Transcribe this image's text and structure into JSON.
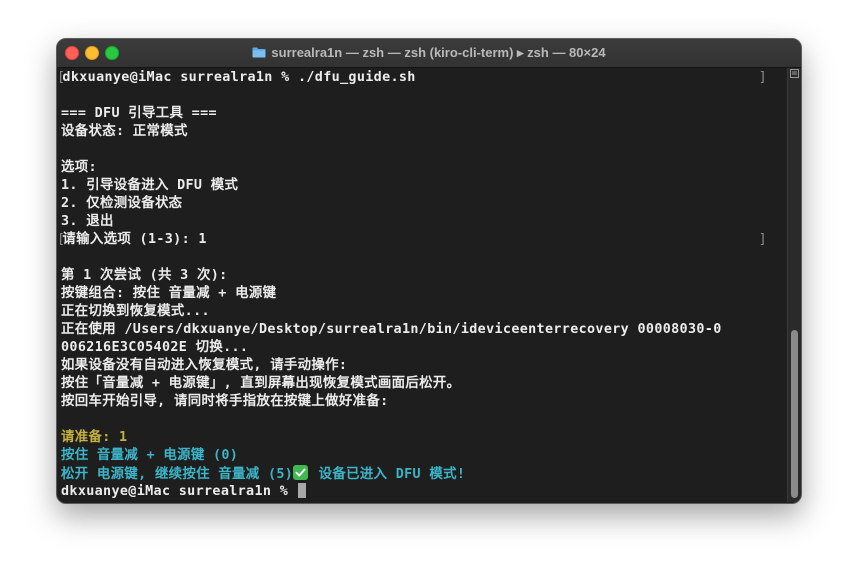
{
  "window": {
    "title": "surrealra1n — zsh — zsh (kiro-cli-term) ▸ zsh — 80×24"
  },
  "terminal": {
    "lines": [
      {
        "text": "dkxuanye@iMac surrealra1n % ./dfu_guide.sh",
        "style": "normal",
        "marked": true
      },
      {
        "text": "",
        "style": "normal"
      },
      {
        "text": "=== DFU 引导工具 ===",
        "style": "normal"
      },
      {
        "text": "设备状态: 正常模式",
        "style": "normal"
      },
      {
        "text": "",
        "style": "normal"
      },
      {
        "text": "选项:",
        "style": "normal"
      },
      {
        "text": "1. 引导设备进入 DFU 模式",
        "style": "normal"
      },
      {
        "text": "2. 仅检测设备状态",
        "style": "normal"
      },
      {
        "text": "3. 退出",
        "style": "normal"
      },
      {
        "text": "请输入选项 (1-3): 1",
        "style": "normal",
        "marked": true
      },
      {
        "text": "",
        "style": "normal"
      },
      {
        "text": "第 1 次尝试 (共 3 次):",
        "style": "normal"
      },
      {
        "text": "按键组合: 按住 音量减 + 电源键",
        "style": "normal"
      },
      {
        "text": "正在切换到恢复模式...",
        "style": "normal"
      },
      {
        "text": "正在使用 /Users/dkxuanye/Desktop/surrealra1n/bin/ideviceenterrecovery 00008030-0",
        "style": "normal"
      },
      {
        "text": "006216E3C05402E 切换...",
        "style": "normal"
      },
      {
        "text": "如果设备没有自动进入恢复模式, 请手动操作:",
        "style": "normal"
      },
      {
        "text": "按住「音量减 + 电源键」, 直到屏幕出现恢复模式画面后松开。",
        "style": "normal"
      },
      {
        "text": "按回车开始引导, 请同时将手指放在按键上做好准备:",
        "style": "normal"
      },
      {
        "text": "",
        "style": "normal"
      },
      {
        "text": "请准备: 1",
        "style": "yellow"
      },
      {
        "text": "按住 音量减 + 电源键 (0)",
        "style": "cyan"
      },
      {
        "text": "松开 电源键, 继续按住 音量减 (5)",
        "style": "cyan",
        "suffix_icon": "check-mark-icon",
        "suffix": " 设备已进入 DFU 模式!"
      },
      {
        "text": "dkxuanye@iMac surrealra1n % ",
        "style": "normal",
        "cursor": true
      }
    ]
  },
  "colors": {
    "background": "#1e1e1e",
    "text": "#ececec",
    "yellow": "#c4b23e",
    "cyan": "#3cb5c9",
    "check": "#3fb950"
  }
}
